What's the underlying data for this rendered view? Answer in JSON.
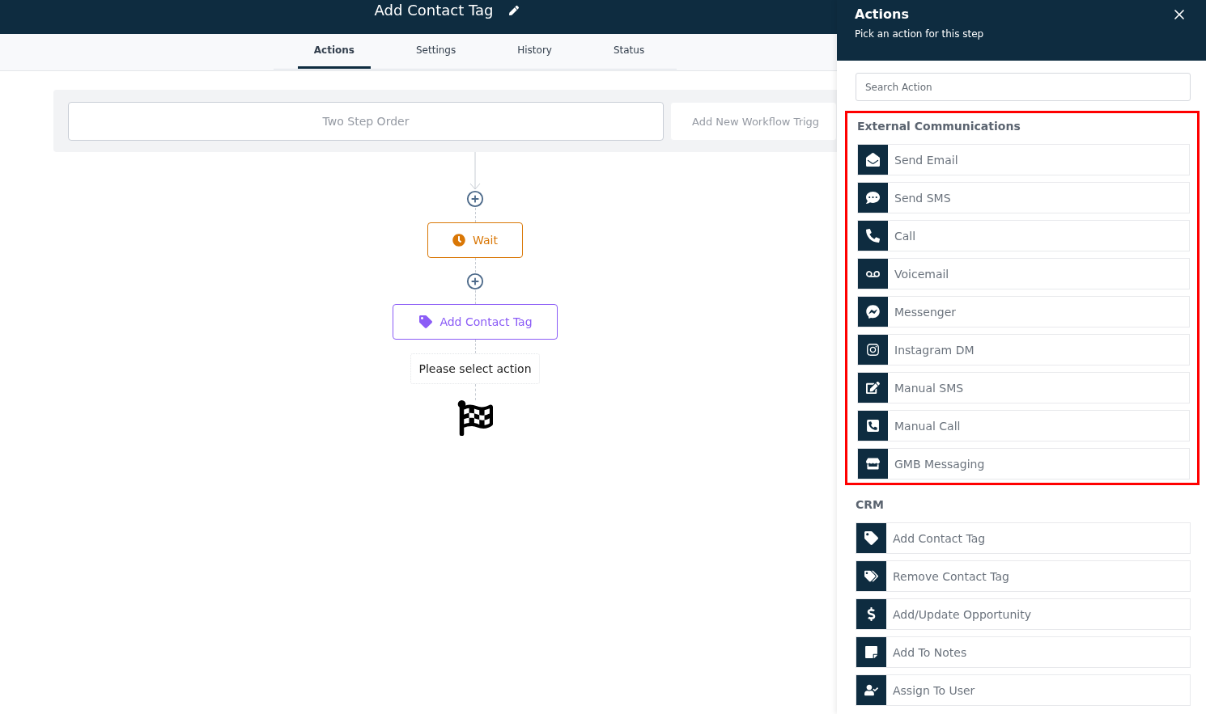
{
  "header": {
    "title": "Add Contact Tag"
  },
  "tabs": [
    {
      "label": "Actions",
      "selected": true
    },
    {
      "label": "Settings",
      "selected": false
    },
    {
      "label": "History",
      "selected": false
    },
    {
      "label": "Status",
      "selected": false
    }
  ],
  "triggers": [
    {
      "label": "Two Step Order"
    },
    {
      "label": "Add New Workflow Trigg"
    }
  ],
  "flow": [
    {
      "kind": "add"
    },
    {
      "kind": "wait",
      "label": "Wait"
    },
    {
      "kind": "add"
    },
    {
      "kind": "action",
      "label": "Add Contact Tag"
    },
    {
      "kind": "note",
      "label": "Please select action"
    },
    {
      "kind": "finish"
    }
  ],
  "panel": {
    "title": "Actions",
    "subtitle": "Pick an action for this step",
    "search": {
      "placeholder": "Search Action"
    },
    "sections": [
      {
        "title": "External Communications",
        "highlighted": true,
        "items": [
          {
            "label": "Send Email"
          },
          {
            "label": "Send SMS"
          },
          {
            "label": "Call"
          },
          {
            "label": "Voicemail"
          },
          {
            "label": "Messenger"
          },
          {
            "label": "Instagram DM"
          },
          {
            "label": "Manual SMS"
          },
          {
            "label": "Manual Call"
          },
          {
            "label": "GMB Messaging"
          }
        ]
      },
      {
        "title": "CRM",
        "highlighted": false,
        "items": [
          {
            "label": "Add Contact Tag"
          },
          {
            "label": "Remove Contact Tag"
          },
          {
            "label": "Add/Update Opportunity"
          },
          {
            "label": "Add To Notes"
          },
          {
            "label": "Assign To User"
          }
        ]
      }
    ]
  }
}
